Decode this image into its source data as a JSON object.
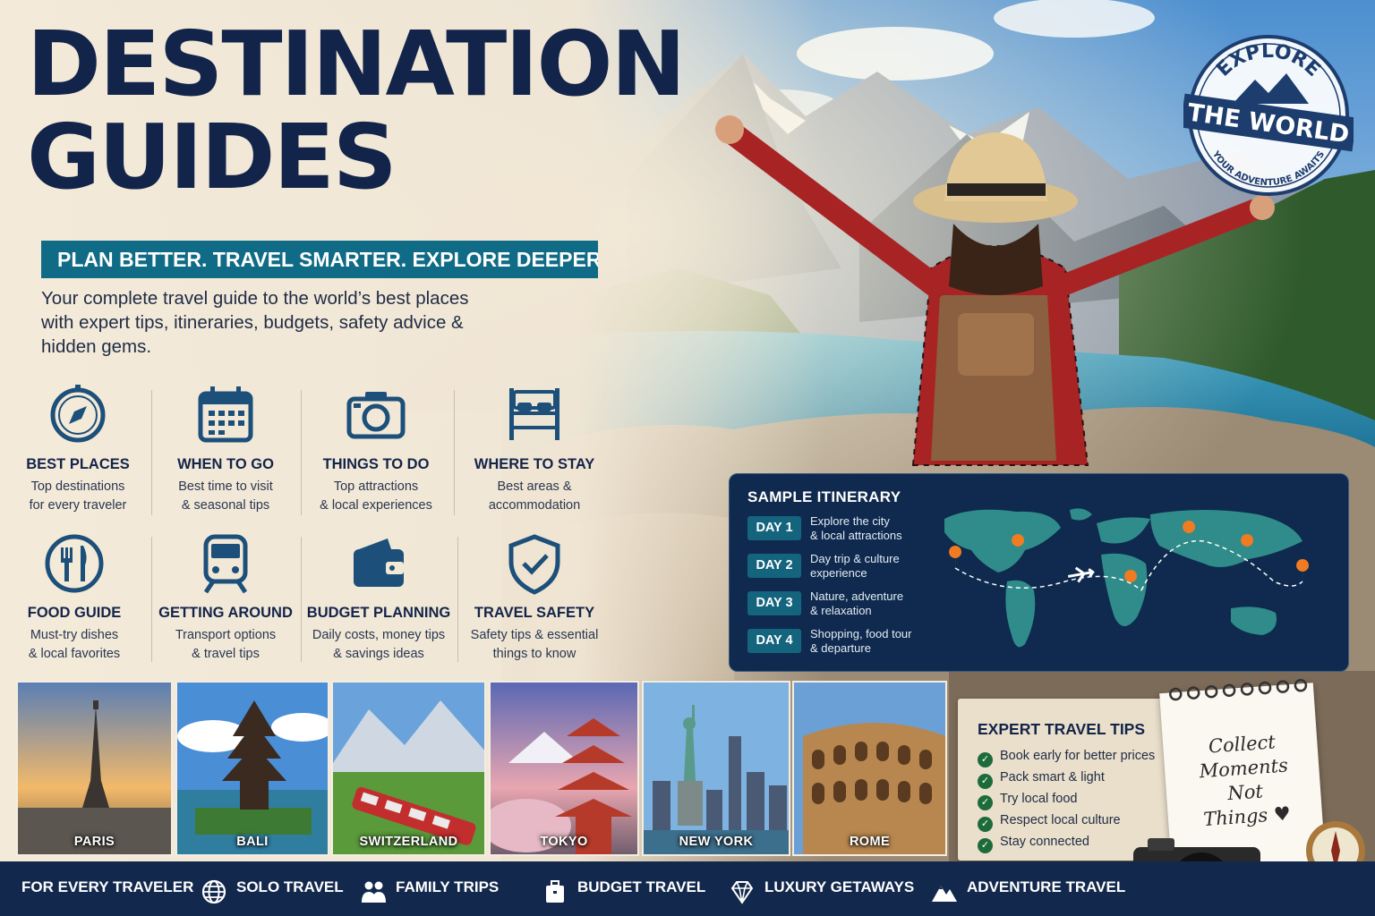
{
  "header": {
    "title_line1": "DESTINATION",
    "title_line2": "GUIDES",
    "tagline": "PLAN BETTER. TRAVEL SMARTER. EXPLORE DEEPER.",
    "intro": "Your complete travel guide to the world’s best places with expert tips, itineraries, budgets, safety advice & hidden gems."
  },
  "badge": {
    "top": "EXPLORE",
    "middle": "THE WORLD",
    "bottom": "YOUR ADVENTURE AWAITS"
  },
  "features": [
    {
      "title": "BEST PLACES",
      "line1": "Top destinations",
      "line2": "for every traveler",
      "icon": "compass-icon"
    },
    {
      "title": "WHEN TO GO",
      "line1": "Best time to visit",
      "line2": "& seasonal tips",
      "icon": "calendar-icon"
    },
    {
      "title": "THINGS TO DO",
      "line1": "Top attractions",
      "line2": "& local experiences",
      "icon": "camera-icon"
    },
    {
      "title": "WHERE TO STAY",
      "line1": "Best areas &",
      "line2": "accommodation",
      "icon": "bed-icon"
    },
    {
      "title": "FOOD GUIDE",
      "line1": "Must-try dishes",
      "line2": "& local favorites",
      "icon": "fork-knife-icon"
    },
    {
      "title": "GETTING AROUND",
      "line1": "Transport options",
      "line2": "& travel tips",
      "icon": "train-icon"
    },
    {
      "title": "BUDGET PLANNING",
      "line1": "Daily costs, money tips",
      "line2": "& savings ideas",
      "icon": "wallet-icon"
    },
    {
      "title": "TRAVEL SAFETY",
      "line1": "Safety tips & essential",
      "line2": "things to know",
      "icon": "shield-check-icon"
    }
  ],
  "itinerary": {
    "title": "SAMPLE ITINERARY",
    "days": [
      {
        "label": "DAY 1",
        "line1": "Explore the city",
        "line2": "& local attractions"
      },
      {
        "label": "DAY 2",
        "line1": "Day trip & culture",
        "line2": "experience"
      },
      {
        "label": "DAY 3",
        "line1": "Nature, adventure",
        "line2": "& relaxation"
      },
      {
        "label": "DAY 4",
        "line1": "Shopping, food tour",
        "line2": "& departure"
      }
    ]
  },
  "destinations": [
    "PARIS",
    "BALI",
    "SWITZERLAND",
    "TOKYO",
    "NEW YORK",
    "ROME"
  ],
  "tips": {
    "title": "EXPERT TRAVEL TIPS",
    "items": [
      "Book early for better prices",
      "Pack smart & light",
      "Try local food",
      "Respect local culture",
      "Stay connected"
    ]
  },
  "notepad": {
    "line1": "Collect",
    "line2": "Moments",
    "line3": "Not",
    "line4": "Things"
  },
  "footer": {
    "lead": "FOR EVERY TRAVELER",
    "items": [
      {
        "label": "SOLO TRAVEL",
        "icon": "globe-icon"
      },
      {
        "label": "FAMILY TRIPS",
        "icon": "family-icon"
      },
      {
        "label": "BUDGET TRAVEL",
        "icon": "suitcase-icon"
      },
      {
        "label": "LUXURY GETAWAYS",
        "icon": "diamond-icon"
      },
      {
        "label": "ADVENTURE TRAVEL",
        "icon": "mountain-icon"
      }
    ]
  },
  "colors": {
    "navy": "#13244a",
    "teal": "#0f6b86",
    "itinerary_bg": "#0f2a4e",
    "pin": "#f07b22",
    "check": "#1e6b3a"
  }
}
